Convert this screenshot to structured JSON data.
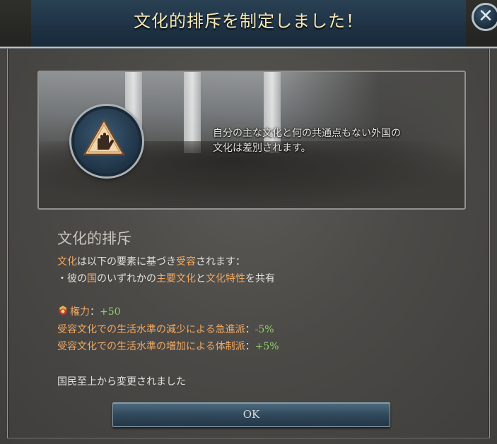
{
  "dialog": {
    "title": "文化的排斥を制定しました！",
    "close_icon": "close-icon"
  },
  "banner": {
    "icon": "raised-hand-warning-icon",
    "description_line1": "自分の主な文化と何の共通点もない外国の",
    "description_line2": "文化は差別されます。"
  },
  "law": {
    "title": "文化的排斥",
    "acceptance_line": {
      "part1": "文化",
      "part2": "は以下の要素に基づき",
      "part3": "受容",
      "part4": "されます："
    },
    "criteria_line": {
      "bullet": "・",
      "part1": "彼の",
      "part2": "国",
      "part3": "のいずれかの",
      "part4": "主要文化",
      "part5": "と",
      "part6": "文化特性",
      "part7": "を共有"
    },
    "effects": [
      {
        "icon": "authority-icon",
        "label": "権力",
        "separator": "：",
        "value": "+50"
      },
      {
        "label": "受容文化での生活水準の減少による急進派",
        "separator": "：",
        "value": "-5%"
      },
      {
        "label": "受容文化での生活水準の増加による体制派",
        "separator": "：",
        "value": "+5%"
      }
    ],
    "changed_from": "国民至上から変更されました"
  },
  "buttons": {
    "ok_label": "OK"
  },
  "colors": {
    "title": "#f4e7b8",
    "highlight_orange": "#f1a862",
    "positive_green": "#8fd06a",
    "header_blue": "#1f3345"
  }
}
